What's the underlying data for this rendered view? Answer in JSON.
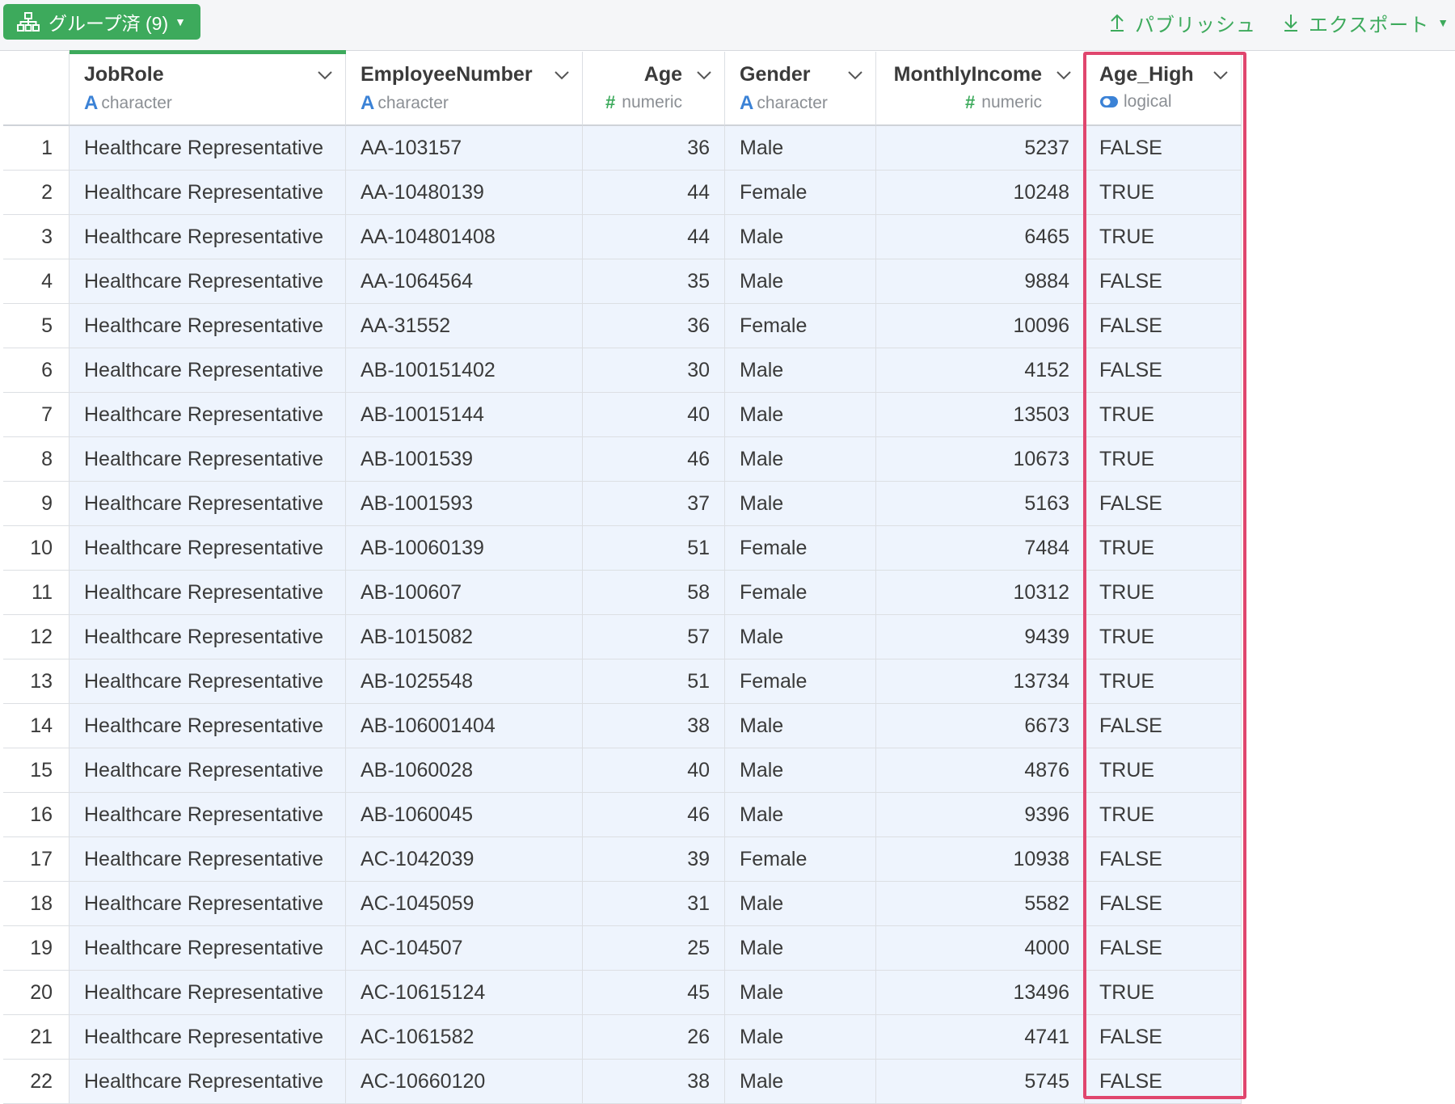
{
  "toolbar": {
    "group_label": "グループ済 (9)",
    "publish_label": "パブリッシュ",
    "export_label": "エクスポート"
  },
  "columns": [
    {
      "name": "JobRole",
      "type": "character",
      "type_icon": "A"
    },
    {
      "name": "EmployeeNumber",
      "type": "character",
      "type_icon": "A"
    },
    {
      "name": "Age",
      "type": "numeric",
      "type_icon": "#"
    },
    {
      "name": "Gender",
      "type": "character",
      "type_icon": "A"
    },
    {
      "name": "MonthlyIncome",
      "type": "numeric",
      "type_icon": "#"
    },
    {
      "name": "Age_High",
      "type": "logical",
      "type_icon": "toggle-icon"
    }
  ],
  "rows": [
    {
      "idx": "1",
      "JobRole": "Healthcare Representative",
      "EmployeeNumber": "AA-103157",
      "Age": "36",
      "Gender": "Male",
      "MonthlyIncome": "5237",
      "Age_High": "FALSE"
    },
    {
      "idx": "2",
      "JobRole": "Healthcare Representative",
      "EmployeeNumber": "AA-10480139",
      "Age": "44",
      "Gender": "Female",
      "MonthlyIncome": "10248",
      "Age_High": "TRUE"
    },
    {
      "idx": "3",
      "JobRole": "Healthcare Representative",
      "EmployeeNumber": "AA-104801408",
      "Age": "44",
      "Gender": "Male",
      "MonthlyIncome": "6465",
      "Age_High": "TRUE"
    },
    {
      "idx": "4",
      "JobRole": "Healthcare Representative",
      "EmployeeNumber": "AA-1064564",
      "Age": "35",
      "Gender": "Male",
      "MonthlyIncome": "9884",
      "Age_High": "FALSE"
    },
    {
      "idx": "5",
      "JobRole": "Healthcare Representative",
      "EmployeeNumber": "AA-31552",
      "Age": "36",
      "Gender": "Female",
      "MonthlyIncome": "10096",
      "Age_High": "FALSE"
    },
    {
      "idx": "6",
      "JobRole": "Healthcare Representative",
      "EmployeeNumber": "AB-100151402",
      "Age": "30",
      "Gender": "Male",
      "MonthlyIncome": "4152",
      "Age_High": "FALSE"
    },
    {
      "idx": "7",
      "JobRole": "Healthcare Representative",
      "EmployeeNumber": "AB-10015144",
      "Age": "40",
      "Gender": "Male",
      "MonthlyIncome": "13503",
      "Age_High": "TRUE"
    },
    {
      "idx": "8",
      "JobRole": "Healthcare Representative",
      "EmployeeNumber": "AB-1001539",
      "Age": "46",
      "Gender": "Male",
      "MonthlyIncome": "10673",
      "Age_High": "TRUE"
    },
    {
      "idx": "9",
      "JobRole": "Healthcare Representative",
      "EmployeeNumber": "AB-1001593",
      "Age": "37",
      "Gender": "Male",
      "MonthlyIncome": "5163",
      "Age_High": "FALSE"
    },
    {
      "idx": "10",
      "JobRole": "Healthcare Representative",
      "EmployeeNumber": "AB-10060139",
      "Age": "51",
      "Gender": "Female",
      "MonthlyIncome": "7484",
      "Age_High": "TRUE"
    },
    {
      "idx": "11",
      "JobRole": "Healthcare Representative",
      "EmployeeNumber": "AB-100607",
      "Age": "58",
      "Gender": "Female",
      "MonthlyIncome": "10312",
      "Age_High": "TRUE"
    },
    {
      "idx": "12",
      "JobRole": "Healthcare Representative",
      "EmployeeNumber": "AB-1015082",
      "Age": "57",
      "Gender": "Male",
      "MonthlyIncome": "9439",
      "Age_High": "TRUE"
    },
    {
      "idx": "13",
      "JobRole": "Healthcare Representative",
      "EmployeeNumber": "AB-1025548",
      "Age": "51",
      "Gender": "Female",
      "MonthlyIncome": "13734",
      "Age_High": "TRUE"
    },
    {
      "idx": "14",
      "JobRole": "Healthcare Representative",
      "EmployeeNumber": "AB-106001404",
      "Age": "38",
      "Gender": "Male",
      "MonthlyIncome": "6673",
      "Age_High": "FALSE"
    },
    {
      "idx": "15",
      "JobRole": "Healthcare Representative",
      "EmployeeNumber": "AB-1060028",
      "Age": "40",
      "Gender": "Male",
      "MonthlyIncome": "4876",
      "Age_High": "TRUE"
    },
    {
      "idx": "16",
      "JobRole": "Healthcare Representative",
      "EmployeeNumber": "AB-1060045",
      "Age": "46",
      "Gender": "Male",
      "MonthlyIncome": "9396",
      "Age_High": "TRUE"
    },
    {
      "idx": "17",
      "JobRole": "Healthcare Representative",
      "EmployeeNumber": "AC-1042039",
      "Age": "39",
      "Gender": "Female",
      "MonthlyIncome": "10938",
      "Age_High": "FALSE"
    },
    {
      "idx": "18",
      "JobRole": "Healthcare Representative",
      "EmployeeNumber": "AC-1045059",
      "Age": "31",
      "Gender": "Male",
      "MonthlyIncome": "5582",
      "Age_High": "FALSE"
    },
    {
      "idx": "19",
      "JobRole": "Healthcare Representative",
      "EmployeeNumber": "AC-104507",
      "Age": "25",
      "Gender": "Male",
      "MonthlyIncome": "4000",
      "Age_High": "FALSE"
    },
    {
      "idx": "20",
      "JobRole": "Healthcare Representative",
      "EmployeeNumber": "AC-10615124",
      "Age": "45",
      "Gender": "Male",
      "MonthlyIncome": "13496",
      "Age_High": "TRUE"
    },
    {
      "idx": "21",
      "JobRole": "Healthcare Representative",
      "EmployeeNumber": "AC-1061582",
      "Age": "26",
      "Gender": "Male",
      "MonthlyIncome": "4741",
      "Age_High": "FALSE"
    },
    {
      "idx": "22",
      "JobRole": "Healthcare Representative",
      "EmployeeNumber": "AC-10660120",
      "Age": "38",
      "Gender": "Male",
      "MonthlyIncome": "5745",
      "Age_High": "FALSE"
    }
  ],
  "colors": {
    "accent_green": "#3daa5c",
    "highlight_pink": "#e0466e",
    "character_blue": "#3b82d6",
    "row_background": "#eef4fd"
  }
}
